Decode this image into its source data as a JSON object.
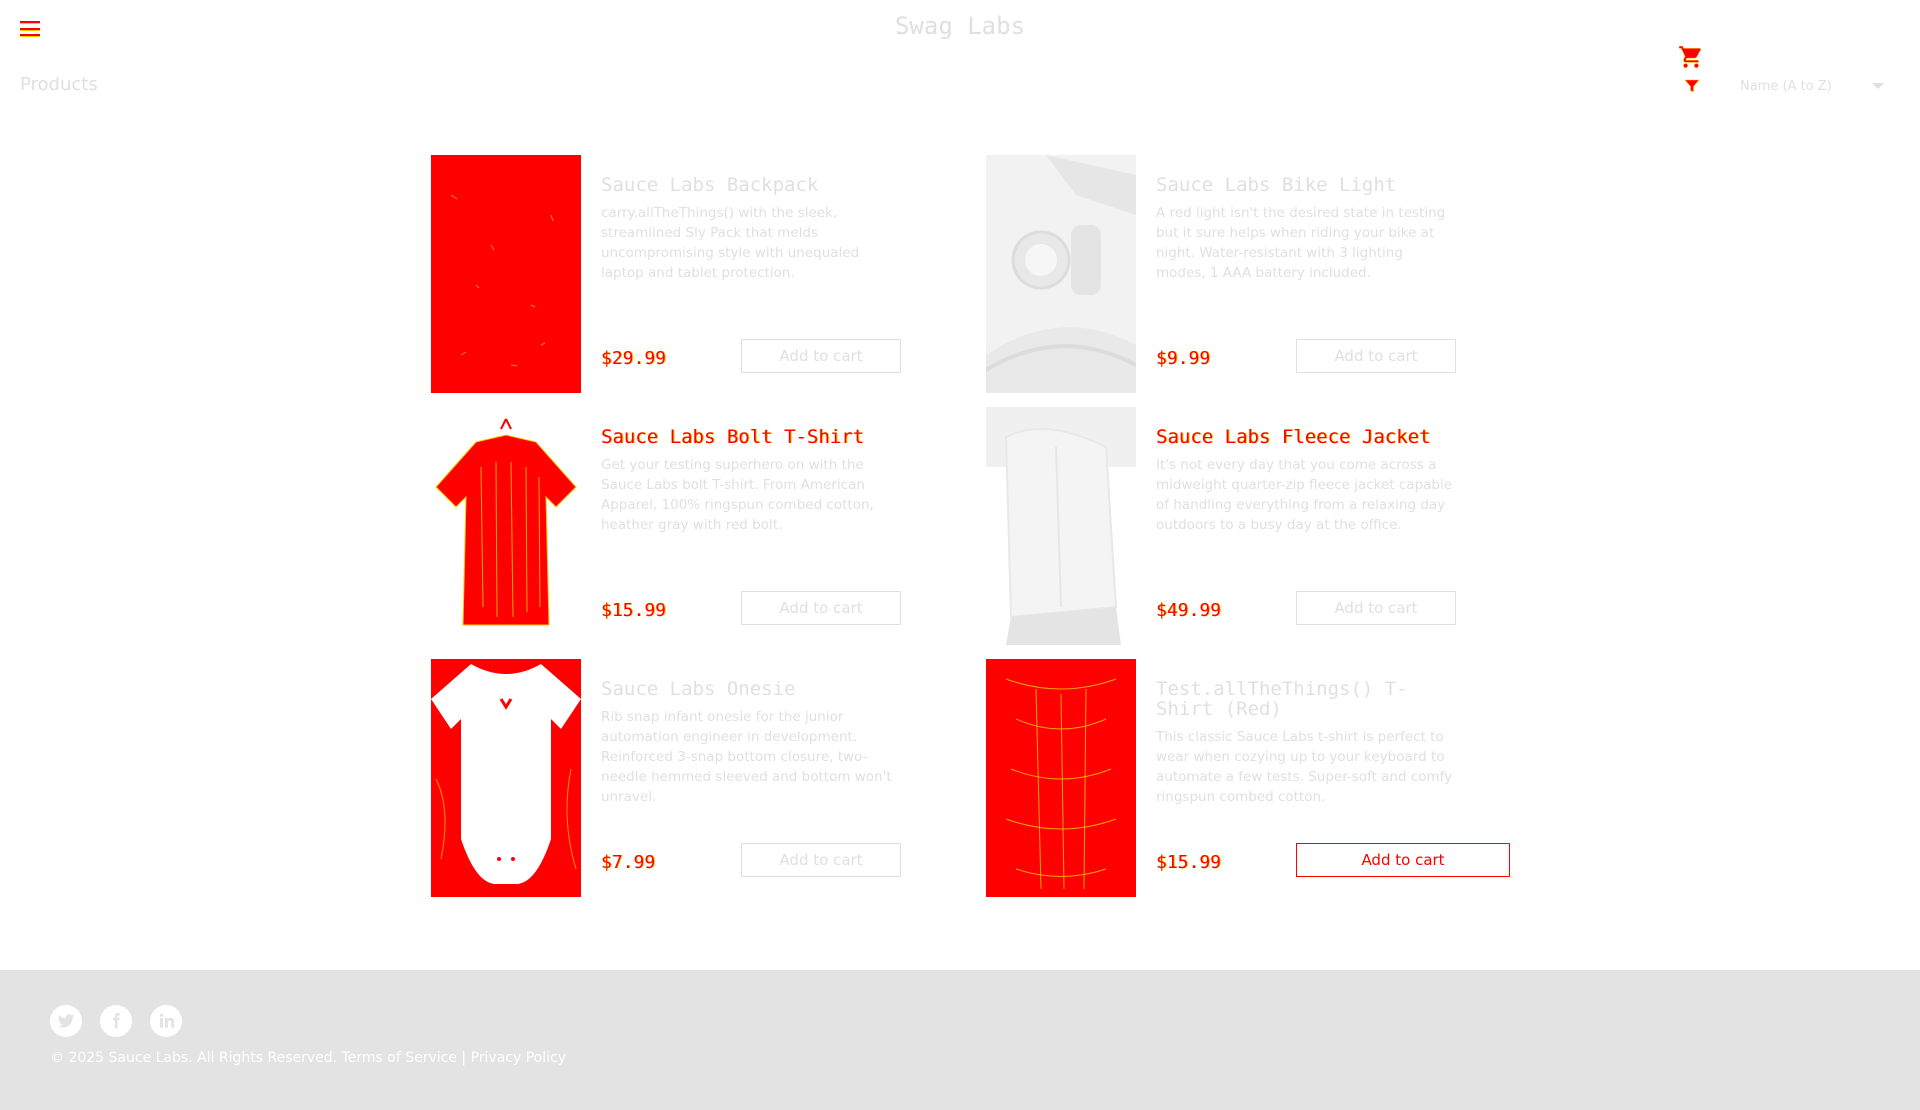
{
  "header": {
    "app_logo": "Swag Labs",
    "page_title": "Products"
  },
  "sort": {
    "selected": "Name (A to Z)"
  },
  "inventory": [
    {
      "name": "Sauce Labs Backpack",
      "description": "carry.allTheThings() with the sleek, streamlined Sly Pack that melds uncompromising style with unequaled laptop and tablet protection.",
      "price": "$29.99",
      "button_label": "Add to cart"
    },
    {
      "name": "Sauce Labs Bike Light",
      "description": "A red light isn't the desired state in testing but it sure helps when riding your bike at night. Water-resistant with 3 lighting modes, 1 AAA battery included.",
      "price": "$9.99",
      "button_label": "Add to cart"
    },
    {
      "name": "Sauce Labs Bolt T-Shirt",
      "description": "Get your testing superhero on with the Sauce Labs bolt T-shirt. From American Apparel, 100% ringspun combed cotton, heather gray with red bolt.",
      "price": "$15.99",
      "button_label": "Add to cart"
    },
    {
      "name": "Sauce Labs Fleece Jacket",
      "description": "It's not every day that you come across a midweight quarter-zip fleece jacket capable of handling everything from a relaxing day outdoors to a busy day at the office.",
      "price": "$49.99",
      "button_label": "Add to cart"
    },
    {
      "name": "Sauce Labs Onesie",
      "description": "Rib snap infant onesie for the junior automation engineer in development. Reinforced 3-snap bottom closure, two-needle hemmed sleeved and bottom won't unravel.",
      "price": "$7.99",
      "button_label": "Add to cart"
    },
    {
      "name": "Test.allTheThings() T-Shirt (Red)",
      "description": "This classic Sauce Labs t-shirt is perfect to wear when cozying up to your keyboard to automate a few tests. Super-soft and comfy ringspun combed cotton.",
      "price": "$15.99",
      "button_label": "Add to cart"
    }
  ],
  "footer": {
    "copy": "© 2025 Sauce Labs. All Rights Reserved.",
    "terms": "Terms of Service",
    "separator": "|",
    "privacy": "Privacy Policy"
  },
  "icons": {
    "menu": "hamburger-menu-icon",
    "cart": "shopping-cart-icon",
    "filter": "filter-icon",
    "twitter": "twitter-icon",
    "facebook": "facebook-icon",
    "linkedin": "linkedin-icon"
  },
  "colors": {
    "highlight": "#ff0000",
    "highlight_edge": "#ffcc00",
    "faded_text": "#e0e0e0",
    "footer_bg": "#e3e3e3"
  }
}
